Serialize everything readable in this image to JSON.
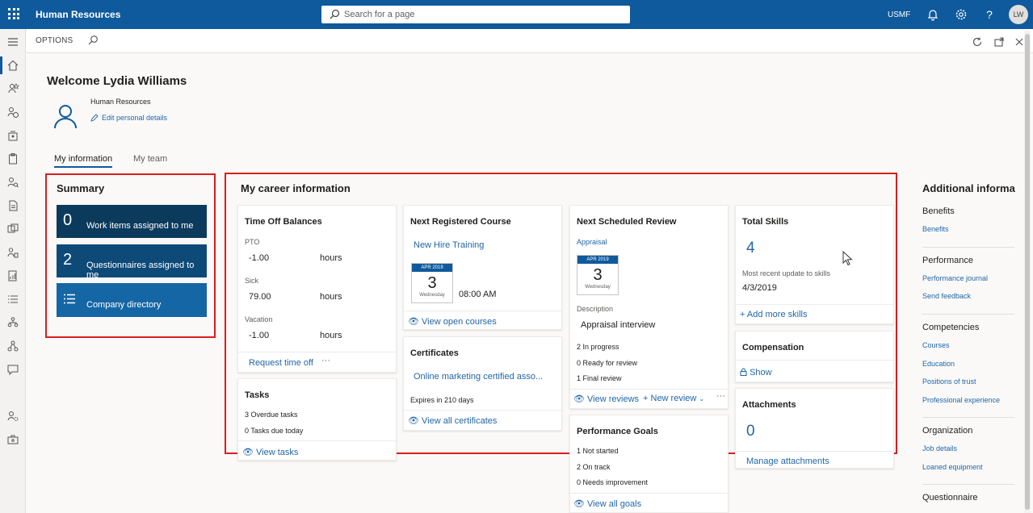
{
  "topbar": {
    "app_title": "Human Resources",
    "search_placeholder": "Search for a page",
    "company": "USMF",
    "avatar_initials": "LW"
  },
  "actionbar": {
    "options_label": "OPTIONS"
  },
  "header": {
    "welcome": "Welcome Lydia Williams",
    "department": "Human Resources",
    "edit_link": "Edit personal details"
  },
  "tabs": [
    {
      "label": "My information"
    },
    {
      "label": "My team"
    }
  ],
  "summary": {
    "title": "Summary",
    "tiles": [
      {
        "count": "0",
        "label": "Work items assigned to me",
        "color": "#0b3a5c"
      },
      {
        "count": "2",
        "label": "Questionnaires assigned to me",
        "color": "#0d4a78"
      },
      {
        "label": "Company directory",
        "color": "#1566a4",
        "icon": "list-icon"
      }
    ]
  },
  "career": {
    "title": "My career information",
    "time_off": {
      "title": "Time Off Balances",
      "rows": [
        {
          "name": "PTO",
          "value": "-1.00",
          "unit": "hours"
        },
        {
          "name": "Sick",
          "value": "79.00",
          "unit": "hours"
        },
        {
          "name": "Vacation",
          "value": "-1.00",
          "unit": "hours"
        }
      ],
      "action": "Request time off",
      "more": "···"
    },
    "tasks": {
      "title": "Tasks",
      "overdue": "3 Overdue tasks",
      "due_today": "0 Tasks due today",
      "link": "View tasks"
    },
    "course": {
      "title": "Next Registered Course",
      "name": "New Hire Training",
      "month": "APR 2019",
      "day": "3",
      "weekday": "Wednesday",
      "time": "08:00 AM",
      "link": "View open courses"
    },
    "certificates": {
      "title": "Certificates",
      "name": "Online marketing certified asso...",
      "expires": "Expires in 210 days",
      "link": "View all certificates"
    },
    "review": {
      "title": "Next Scheduled Review",
      "type": "Appraisal",
      "month": "APR 2019",
      "day": "3",
      "weekday": "Wednesday",
      "desc_label": "Description",
      "desc": "Appraisal interview",
      "in_progress": "2 In progress",
      "ready": "0 Ready for review",
      "final": "1 Final review",
      "link_view": "View reviews",
      "link_new": "New review",
      "more": "···"
    },
    "goals": {
      "title": "Performance Goals",
      "not_started": "1 Not started",
      "on_track": "2 On track",
      "needs": "0 Needs improvement",
      "link": "View all goals"
    },
    "skills": {
      "title": "Total Skills",
      "count": "4",
      "recent_label": "Most recent update to skills",
      "recent_date": "4/3/2019",
      "link": "Add more skills"
    },
    "compensation": {
      "title": "Compensation",
      "link": "Show"
    },
    "attachments": {
      "title": "Attachments",
      "count": "0",
      "link": "Manage attachments"
    }
  },
  "additional": {
    "title": "Additional informa",
    "groups": [
      {
        "heading": "Benefits",
        "links": [
          "Benefits"
        ]
      },
      {
        "heading": "Performance",
        "links": [
          "Performance journal",
          "Send feedback"
        ]
      },
      {
        "heading": "Competencies",
        "links": [
          "Courses",
          "Education",
          "Positions of trust",
          "Professional experience"
        ]
      },
      {
        "heading": "Organization",
        "links": [
          "Job details",
          "Loaned equipment"
        ]
      },
      {
        "heading": "Questionnaire",
        "links": []
      }
    ]
  }
}
